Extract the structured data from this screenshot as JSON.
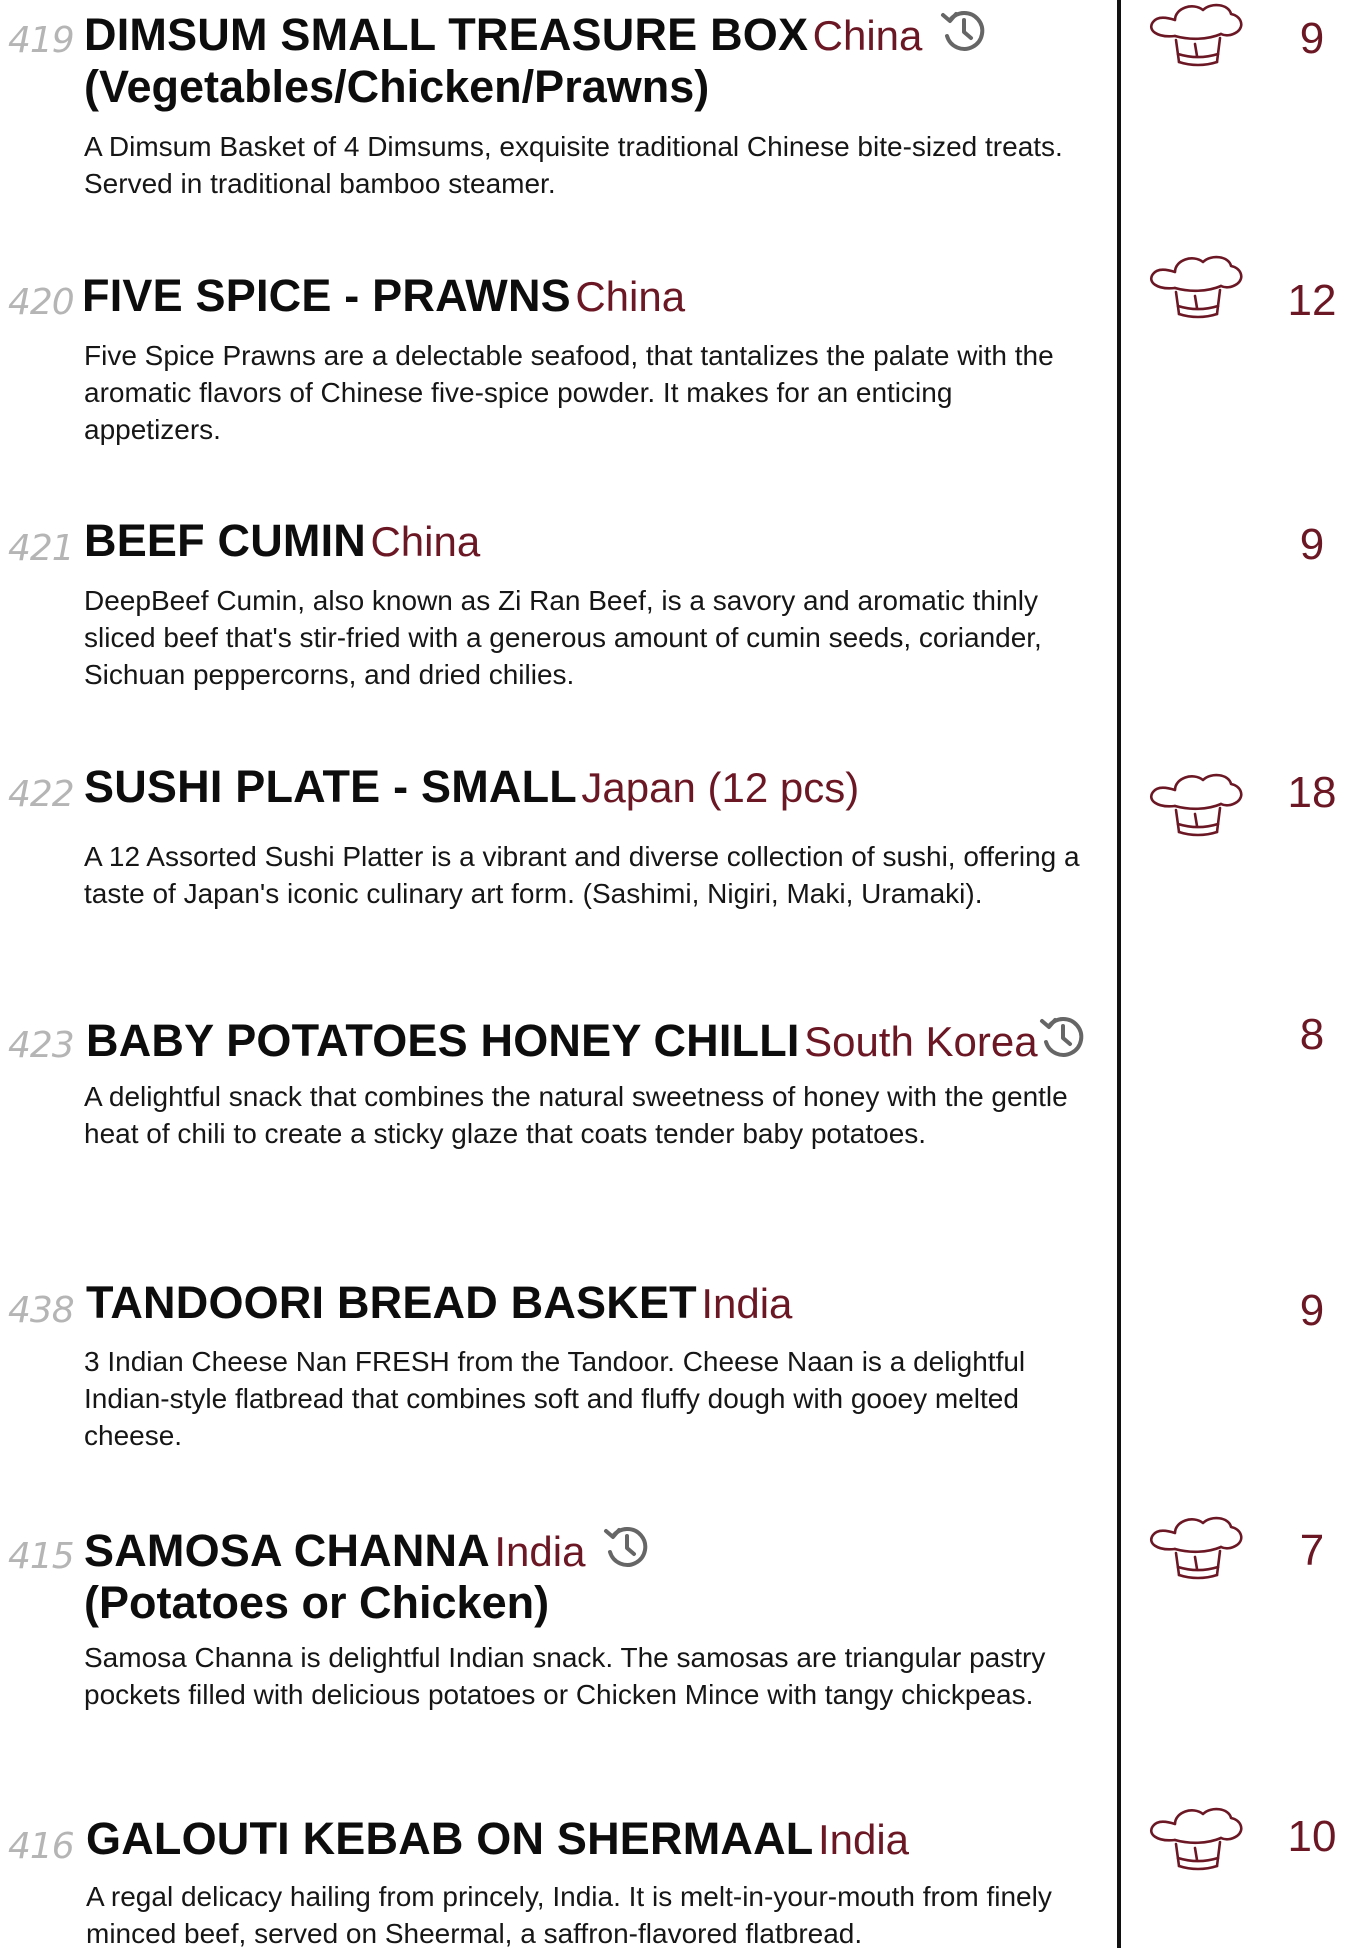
{
  "colors": {
    "accent": "#6b1724",
    "title": "#0d0d0d",
    "number": "#b5b5b5",
    "icon_grey": "#666666"
  },
  "icons": {
    "prep_time": "clock-history-icon",
    "chef_special": "chef-hat-icon"
  },
  "items": [
    {
      "number": "419",
      "title": "DIMSUM SMALL TREASURE BOX",
      "origin": "China",
      "subtitle": "(Vegetables/Chicken/Prawns)",
      "description": "A Dimsum Basket of 4 Dimsums, exquisite traditional Chinese bite-sized treats. Served in traditional bamboo steamer.",
      "price": "9",
      "has_clock": true,
      "has_chef_hat": true
    },
    {
      "number": "420",
      "title": "FIVE SPICE - PRAWNS",
      "origin": "China",
      "description": "Five Spice Prawns are a delectable seafood, that tantalizes the palate with the aromatic flavors of Chinese five-spice powder. It makes for an enticing appetizers.",
      "price": "12",
      "has_clock": false,
      "has_chef_hat": true
    },
    {
      "number": "421",
      "title": "BEEF CUMIN",
      "origin": "China",
      "description": "DeepBeef Cumin, also known as Zi Ran Beef, is a savory and aromatic thinly sliced beef that's stir-fried with a generous amount of cumin seeds, coriander, Sichuan peppercorns, and dried chilies.",
      "price": "9",
      "has_clock": false,
      "has_chef_hat": false
    },
    {
      "number": "422",
      "title": "SUSHI PLATE - SMALL",
      "origin": "Japan (12 pcs)",
      "description": "A 12 Assorted Sushi Platter is a vibrant and diverse collection of sushi, offering a taste of Japan's iconic culinary art form. (Sashimi, Nigiri, Maki, Uramaki).",
      "price": "18",
      "has_clock": false,
      "has_chef_hat": true
    },
    {
      "number": "423",
      "title": "BABY POTATOES HONEY CHILLI",
      "origin": "South Korea",
      "description": "A delightful snack that combines the natural sweetness of honey with the gentle heat of chili to create a sticky glaze that coats tender baby potatoes.",
      "price": "8",
      "has_clock": true,
      "has_chef_hat": false
    },
    {
      "number": "438",
      "title": "TANDOORI BREAD BASKET",
      "origin": "India",
      "description": "3 Indian Cheese Nan FRESH from the Tandoor. Cheese Naan is a delightful Indian-style flatbread that combines soft and fluffy dough with gooey melted cheese.",
      "price": "9",
      "has_clock": false,
      "has_chef_hat": false
    },
    {
      "number": "415",
      "title": "SAMOSA CHANNA",
      "origin": "India",
      "subtitle": "(Potatoes or Chicken)",
      "description": "Samosa Channa is delightful Indian snack. The samosas are triangular pastry pockets filled with delicious potatoes or Chicken Mince with tangy chickpeas.",
      "price": "7",
      "has_clock": true,
      "has_chef_hat": true
    },
    {
      "number": "416",
      "title": "GALOUTI KEBAB ON SHERMAAL",
      "origin": "India",
      "description": "A regal delicacy hailing from princely, India. It is melt-in-your-mouth from finely minced beef, served on Sheermal, a saffron-flavored flatbread.",
      "price": "10",
      "has_clock": false,
      "has_chef_hat": true
    }
  ]
}
